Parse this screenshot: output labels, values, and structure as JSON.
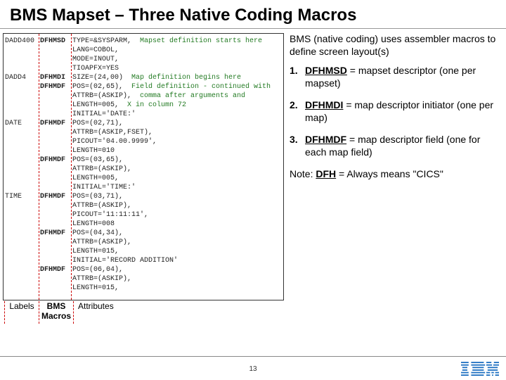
{
  "title": "BMS Mapset – Three Native Coding Macros",
  "intro": "BMS (native coding) uses assembler macros to define screen layout(s)",
  "items": [
    {
      "num": "1.",
      "kw": "DFHMSD",
      "rest": " = mapset descriptor (one per mapset)"
    },
    {
      "num": "2.",
      "kw": "DFHMDI",
      "rest": " = map descriptor initiator (one per map)"
    },
    {
      "num": "3.",
      "kw": "DFHMDF",
      "rest": " = map descriptor field (one for each map field)"
    }
  ],
  "note_prefix": "Note: ",
  "note_kw": "DFH",
  "note_rest": " = Always means \"CICS\"",
  "labels": {
    "l1": "Labels",
    "l2": "BMS\nMacros",
    "l3": "Attributes"
  },
  "page": "13",
  "code": [
    {
      "label": "DADD400",
      "macro": "DFHMSD",
      "args": "TYPE=&SYSPARM,",
      "cmt": "Mapset definition starts here"
    },
    {
      "label": "",
      "macro": "",
      "args": "LANG=COBOL,"
    },
    {
      "label": "",
      "macro": "",
      "args": "MODE=INOUT,"
    },
    {
      "label": "",
      "macro": "",
      "args": "TIOAPFX=YES"
    },
    {
      "label": "DADD4",
      "macro": "DFHMDI",
      "args": "SIZE=(24,00)",
      "cmt": "Map definition begins here"
    },
    {
      "label": "",
      "macro": "DFHMDF",
      "args": "POS=(02,65),",
      "cmt": "Field definition - continued with"
    },
    {
      "label": "",
      "macro": "",
      "args": "ATTRB=(ASKIP),",
      "cmt": "comma after arguments and"
    },
    {
      "label": "",
      "macro": "",
      "args": "LENGTH=005,",
      "cmt": "X in column 72"
    },
    {
      "label": "",
      "macro": "",
      "args": "INITIAL='DATE:'"
    },
    {
      "label": "DATE",
      "macro": "DFHMDF",
      "args": "POS=(02,71),"
    },
    {
      "label": "",
      "macro": "",
      "args": "ATTRB=(ASKIP,FSET),"
    },
    {
      "label": "",
      "macro": "",
      "args": "PICOUT='04.00.9999',"
    },
    {
      "label": "",
      "macro": "",
      "args": "LENGTH=010"
    },
    {
      "label": "",
      "macro": "DFHMDF",
      "args": "POS=(03,65),"
    },
    {
      "label": "",
      "macro": "",
      "args": "ATTRB=(ASKIP),"
    },
    {
      "label": "",
      "macro": "",
      "args": "LENGTH=005,"
    },
    {
      "label": "",
      "macro": "",
      "args": "INITIAL='TIME:'"
    },
    {
      "label": "TIME",
      "macro": "DFHMDF",
      "args": "POS=(03,71),"
    },
    {
      "label": "",
      "macro": "",
      "args": "ATTRB=(ASKIP),"
    },
    {
      "label": "",
      "macro": "",
      "args": "PICOUT='11:11:11',"
    },
    {
      "label": "",
      "macro": "",
      "args": "LENGTH=008"
    },
    {
      "label": "",
      "macro": "DFHMDF",
      "args": "POS=(04,34),"
    },
    {
      "label": "",
      "macro": "",
      "args": "ATTRB=(ASKIP),"
    },
    {
      "label": "",
      "macro": "",
      "args": "LENGTH=015,"
    },
    {
      "label": "",
      "macro": "",
      "args": "INITIAL='RECORD ADDITION'"
    },
    {
      "label": "",
      "macro": "DFHMDF",
      "args": "POS=(06,04),"
    },
    {
      "label": "",
      "macro": "",
      "args": "ATTRB=(ASKIP),"
    },
    {
      "label": "",
      "macro": "",
      "args": "LENGTH=015,"
    }
  ]
}
